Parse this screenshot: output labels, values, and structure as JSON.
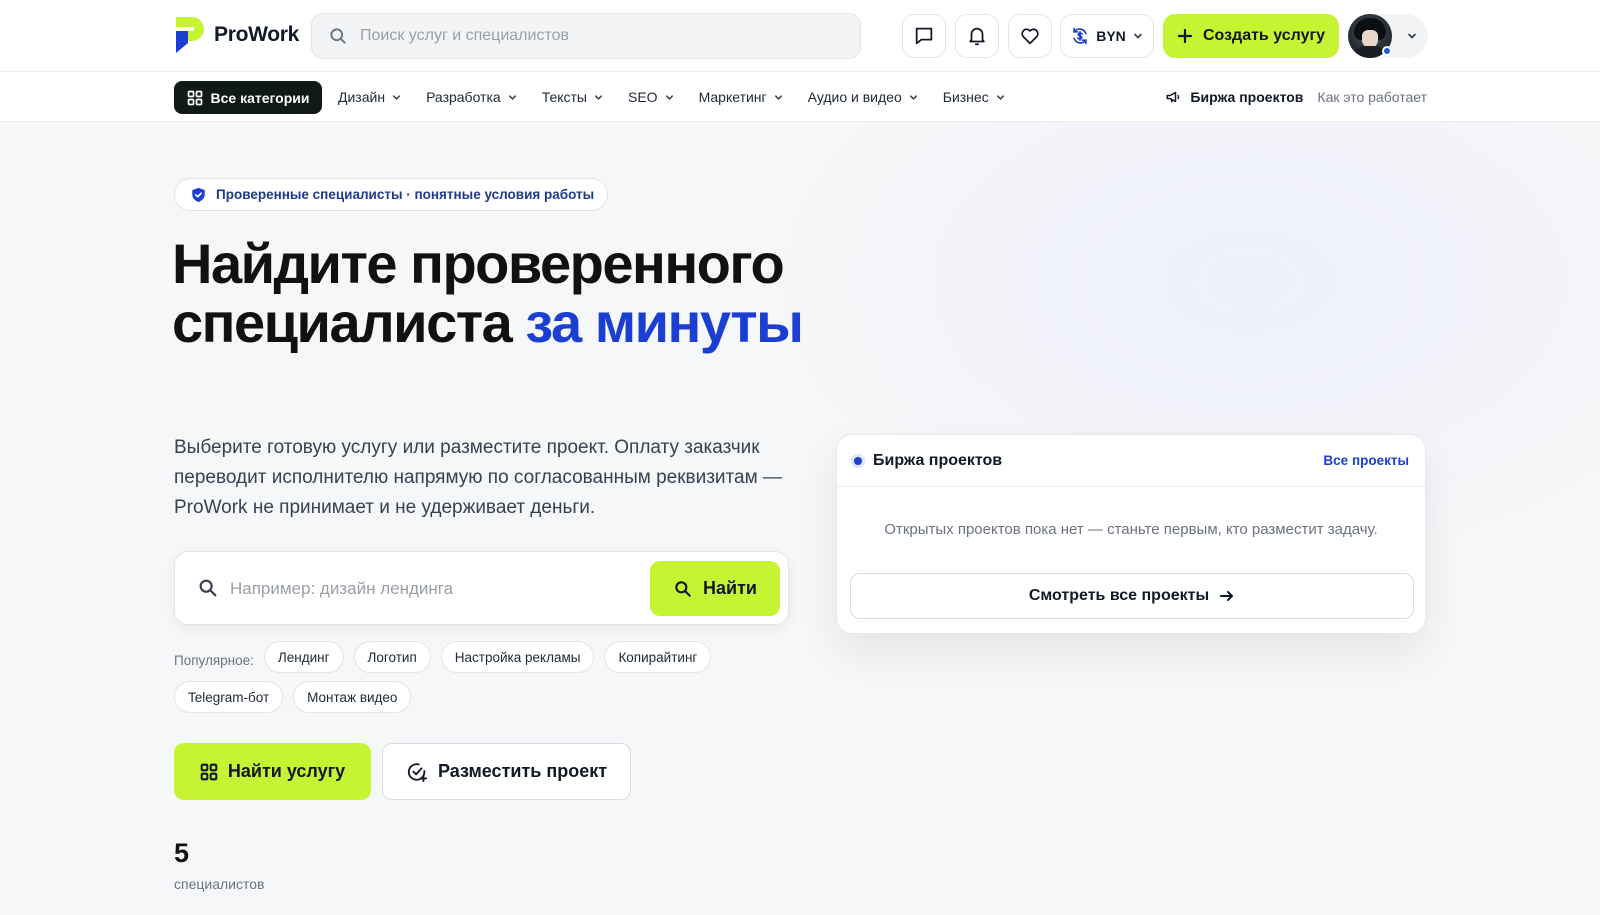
{
  "header": {
    "brand": "ProWork",
    "search_placeholder": "Поиск услуг и специалистов",
    "currency": "BYN",
    "create_label": "Создать услугу"
  },
  "nav": {
    "all_categories": "Все категории",
    "categories": [
      "Дизайн",
      "Разработка",
      "Тексты",
      "SEO",
      "Маркетинг",
      "Аудио и видео",
      "Бизнес"
    ],
    "exchange": "Биржа проектов",
    "how_it_works": "Как это работает"
  },
  "hero": {
    "badge": "Проверенные специалисты · понятные условия работы",
    "title_main": "Найдите проверенного специалиста ",
    "title_accent": "за минуты",
    "subtitle": "Выберите готовую услугу или разместите проект. Оплату заказчик переводит исполнителю напрямую по согласованным реквизитам — ProWork не принимает и не удерживает деньги.",
    "search_placeholder": "Например: дизайн лендинга",
    "search_button": "Найти",
    "popular_label": "Популярное:",
    "popular_tags": [
      "Лендинг",
      "Логотип",
      "Настройка рекламы",
      "Копирайтинг",
      "Telegram-бот",
      "Монтаж видео"
    ],
    "cta_primary": "Найти услугу",
    "cta_secondary": "Разместить проект",
    "stat_value": "5",
    "stat_label": "специалистов"
  },
  "projects": {
    "title": "Биржа проектов",
    "all_link": "Все проекты",
    "empty_text": "Открытых проектов пока нет — станьте первым, кто разместит задачу.",
    "view_all_button": "Смотреть все проекты"
  },
  "colors": {
    "accent_lime": "#c6f432",
    "accent_blue": "#1b3fd1",
    "dark": "#0f1a17"
  },
  "icons": [
    "search-icon",
    "chat-icon",
    "bell-icon",
    "heart-icon",
    "currency-icon",
    "plus-icon",
    "chevron-down-icon",
    "grid-icon",
    "megaphone-icon",
    "shield-icon",
    "check-plus-icon",
    "arrow-right-icon"
  ]
}
